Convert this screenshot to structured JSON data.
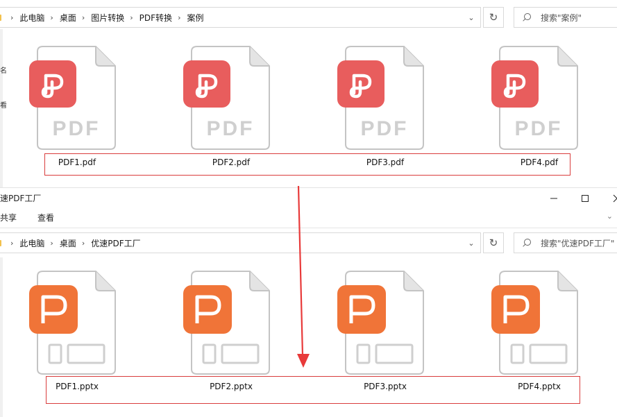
{
  "top_window": {
    "breadcrumb": [
      "此电脑",
      "桌面",
      "图片转换",
      "PDF转换",
      "案例"
    ],
    "search_placeholder": "搜索\"案例\"",
    "files": [
      "PDF1.pdf",
      "PDF2.pdf",
      "PDF3.pdf",
      "PDF4.pdf"
    ],
    "file_badge_label": "PDF",
    "side_chars": [
      "名",
      "看"
    ]
  },
  "bottom_window": {
    "title": "速PDF工厂",
    "ribbon": [
      "共享",
      "查看"
    ],
    "breadcrumb": [
      "此电脑",
      "桌面",
      "优速PDF工厂"
    ],
    "search_placeholder": "搜索\"优速PDF工厂\"",
    "files": [
      "PDF1.pptx",
      "PDF2.pptx",
      "PDF3.pptx",
      "PDF4.pptx"
    ]
  },
  "colors": {
    "pdf_badge": "#e85d5d",
    "ppt_badge": "#f07438",
    "highlight_box": "#d93c3c",
    "arrow": "#e83a3a"
  },
  "icons": {
    "pdf_file": "pdf-file-icon",
    "ppt_file": "pptx-file-icon",
    "folder": "folder-icon",
    "refresh": "refresh-icon",
    "search": "search-icon",
    "dropdown": "chevron-down-icon",
    "minimize": "minimize-icon",
    "maximize": "maximize-icon",
    "close": "close-icon"
  }
}
